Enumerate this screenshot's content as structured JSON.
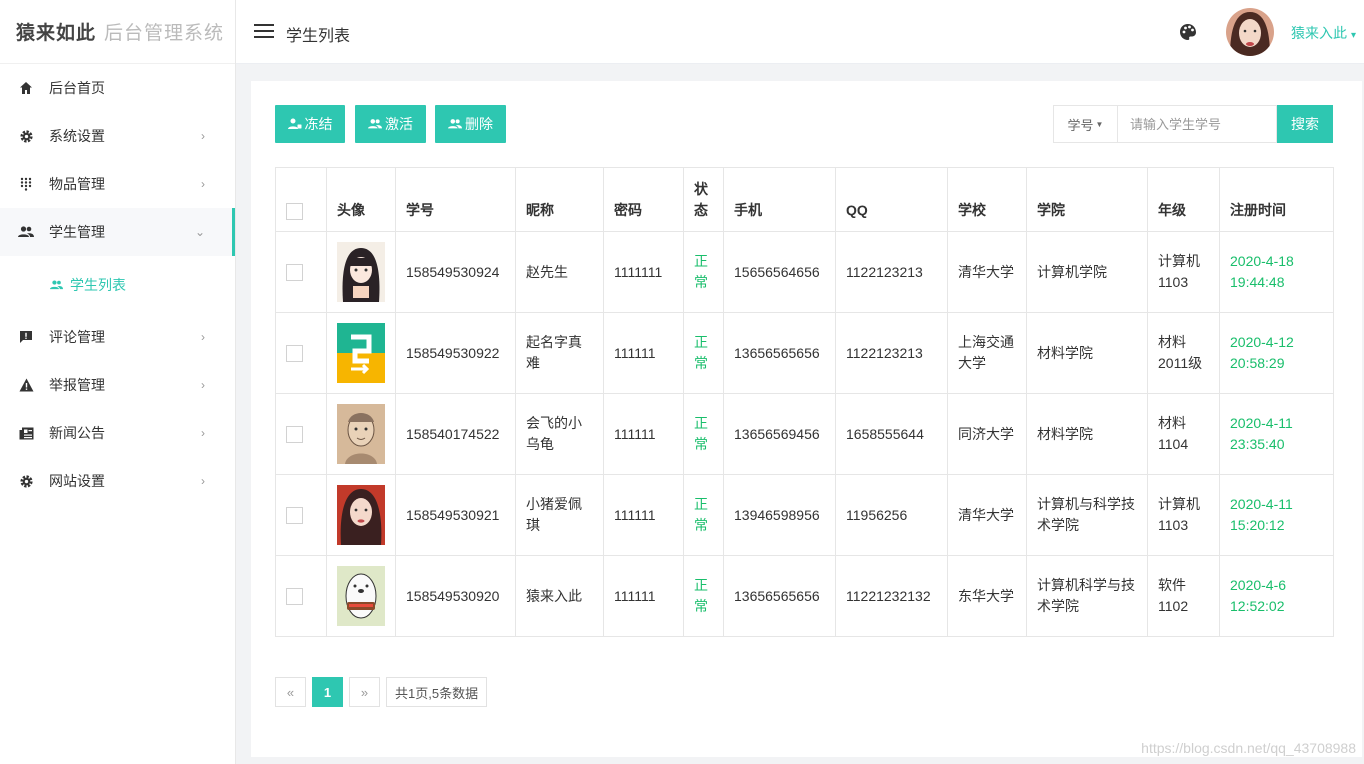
{
  "brand": {
    "name_bold": "猿来如此",
    "name_light": "后台管理系统"
  },
  "sidebar": {
    "items": [
      {
        "label": "后台首页",
        "icon": "home-icon"
      },
      {
        "label": "系统设置",
        "icon": "gear-icon",
        "arrow": "›"
      },
      {
        "label": "物品管理",
        "icon": "grid-dots-icon",
        "arrow": "›"
      },
      {
        "label": "学生管理",
        "icon": "people-icon",
        "arrow": "⌄"
      },
      {
        "label": "评论管理",
        "icon": "comment-icon",
        "arrow": "›"
      },
      {
        "label": "举报管理",
        "icon": "warning-icon",
        "arrow": "›"
      },
      {
        "label": "新闻公告",
        "icon": "news-icon",
        "arrow": "›"
      },
      {
        "label": "网站设置",
        "icon": "gear-icon",
        "arrow": "›"
      }
    ],
    "sub_items": [
      {
        "label": "学生列表",
        "icon": "people-icon"
      }
    ]
  },
  "header": {
    "title": "学生列表",
    "user": "猿来入此",
    "caret": "▾"
  },
  "toolbar": {
    "freeze": "冻结",
    "activate": "激活",
    "delete": "删除"
  },
  "search": {
    "select_value": "学号",
    "placeholder": "请输入学生学号",
    "button": "搜索"
  },
  "table": {
    "headers": [
      "头像",
      "学号",
      "昵称",
      "密码",
      "状态",
      "手机",
      "QQ",
      "学校",
      "学院",
      "年级",
      "注册时间"
    ],
    "rows": [
      {
        "id": "158549530924",
        "nick": "赵先生",
        "pwd": "1111111",
        "status": "正常",
        "phone": "15656564656",
        "qq": "1122123213",
        "school": "清华大学",
        "college": "计算机学院",
        "grade": "计算机1103",
        "time": "2020-4-18 19:44:48"
      },
      {
        "id": "158549530922",
        "nick": "起名字真难",
        "pwd": "111111",
        "status": "正常",
        "phone": "13656565656",
        "qq": "1122123213",
        "school": "上海交通大学",
        "college": "材料学院",
        "grade": "材料2011级",
        "time": "2020-4-12 20:58:29"
      },
      {
        "id": "158540174522",
        "nick": "会飞的小乌龟",
        "pwd": "111111",
        "status": "正常",
        "phone": "13656569456",
        "qq": "1658555644",
        "school": "同济大学",
        "college": "材料学院",
        "grade": "材料1104",
        "time": "2020-4-11 23:35:40"
      },
      {
        "id": "158549530921",
        "nick": "小猪爱佩琪",
        "pwd": "111111",
        "status": "正常",
        "phone": "13946598956",
        "qq": "11956256",
        "school": "清华大学",
        "college": "计算机与科学技术学院",
        "grade": "计算机1103",
        "time": "2020-4-11 15:20:12"
      },
      {
        "id": "158549530920",
        "nick": "猿来入此",
        "pwd": "111111",
        "status": "正常",
        "phone": "13656565656",
        "qq": "11221232132",
        "school": "东华大学",
        "college": "计算机科学与技术学院",
        "grade": "软件1102",
        "time": "2020-4-6 12:52:02"
      }
    ]
  },
  "pager": {
    "prev": "«",
    "current": "1",
    "next": "»",
    "info": "共1页,5条数据"
  },
  "watermark": "https://blog.csdn.net/qq_43708988",
  "colors": {
    "accent": "#2ec7b1",
    "status_green": "#19be6b"
  }
}
